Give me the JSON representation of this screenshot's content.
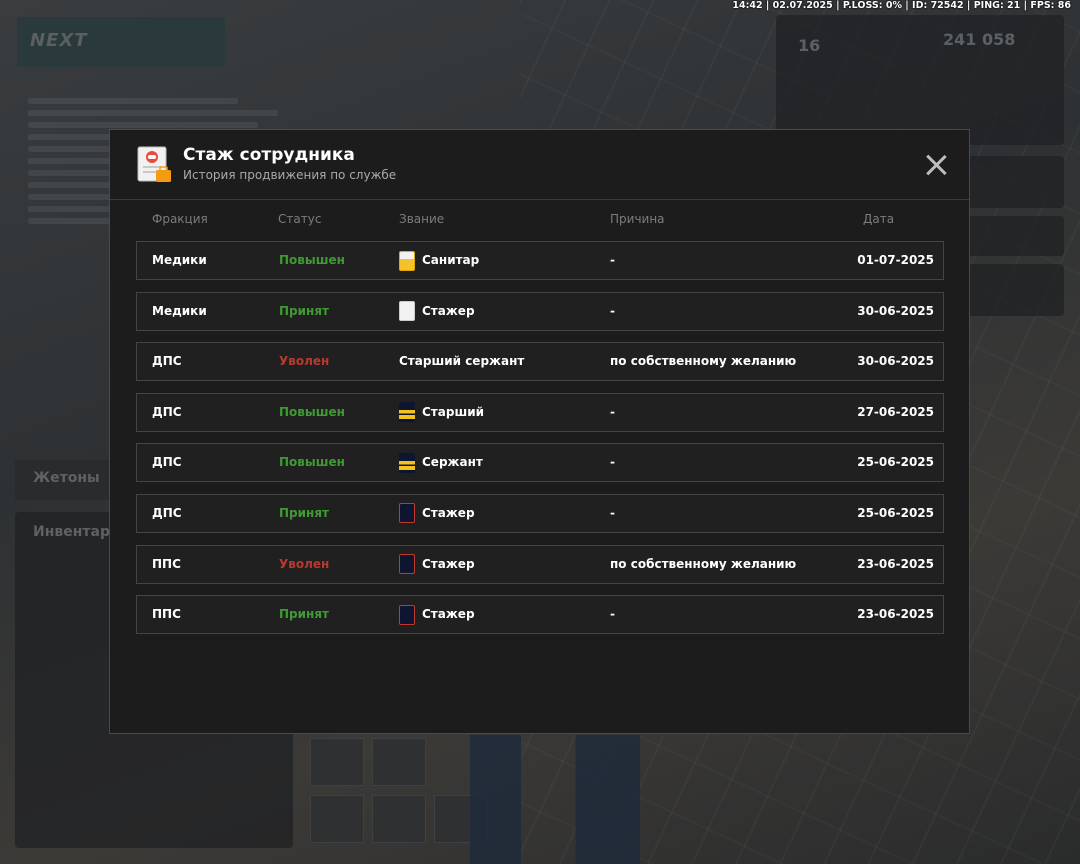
{
  "hud": {
    "text": "14:42 | 02.07.2025 | P.LOSS: 0% | ID: 72542 | PING: 21 | FPS: 86"
  },
  "modal": {
    "title": "Стаж сотрудника",
    "subtitle": "История продвижения по службе",
    "columns": {
      "faction": "Фракция",
      "status": "Статус",
      "rank": "Звание",
      "reason": "Причина",
      "date": "Дата"
    },
    "rows": [
      {
        "faction": "Медики",
        "status": "Повышен",
        "status_type": "promoted",
        "rank": "Санитар",
        "rank_icon": "medic-white-yellow-badge",
        "reason": "-",
        "date": "01-07-2025"
      },
      {
        "faction": "Медики",
        "status": "Принят",
        "status_type": "hired",
        "rank": "Стажер",
        "rank_icon": "medic-white-badge",
        "reason": "-",
        "date": "30-06-2025"
      },
      {
        "faction": "ДПС",
        "status": "Уволен",
        "status_type": "fired",
        "rank": "Старший сержант",
        "rank_icon": "",
        "reason": "по собственному желанию",
        "date": "30-06-2025"
      },
      {
        "faction": "ДПС",
        "status": "Повышен",
        "status_type": "promoted",
        "rank": "Старший",
        "rank_icon": "police-navy-stripes-badge",
        "reason": "-",
        "date": "27-06-2025"
      },
      {
        "faction": "ДПС",
        "status": "Повышен",
        "status_type": "promoted",
        "rank": "Сержант",
        "rank_icon": "police-navy-stripes-badge",
        "reason": "-",
        "date": "25-06-2025"
      },
      {
        "faction": "ДПС",
        "status": "Принят",
        "status_type": "hired",
        "rank": "Стажер",
        "rank_icon": "police-navy-badge",
        "reason": "-",
        "date": "25-06-2025"
      },
      {
        "faction": "ППС",
        "status": "Уволен",
        "status_type": "fired",
        "rank": "Стажер",
        "rank_icon": "police-navy-badge",
        "reason": "по собственному желанию",
        "date": "23-06-2025"
      },
      {
        "faction": "ППС",
        "status": "Принят",
        "status_type": "hired",
        "rank": "Стажер",
        "rank_icon": "police-navy-badge",
        "reason": "-",
        "date": "23-06-2025"
      }
    ]
  },
  "background": {
    "logo": "NEXT",
    "tab_tokens": "Жетоны",
    "tab_inventory": "Инвентарь",
    "stat_level": "16",
    "stat_money": "241 058"
  },
  "colors": {
    "promoted": "#3f9a34",
    "hired": "#3f9a34",
    "fired": "#b8392f",
    "modal_bg": "#1c1c1c"
  }
}
